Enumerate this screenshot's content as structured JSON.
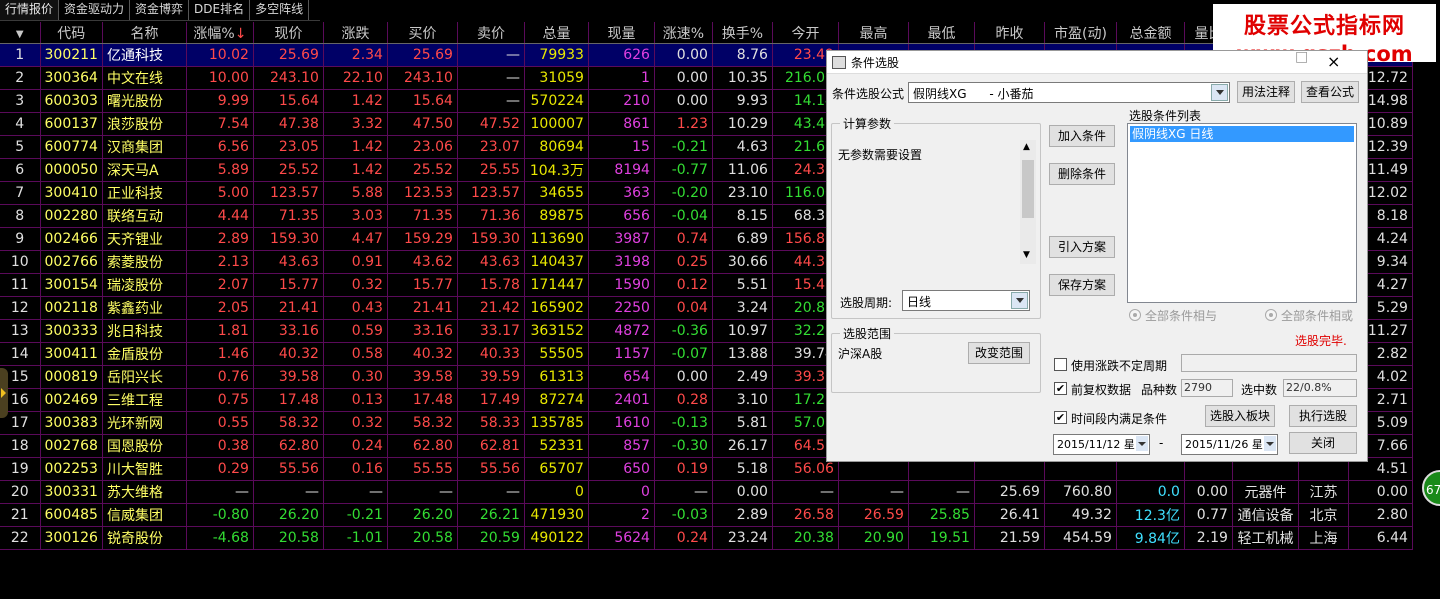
{
  "tabs": [
    "行情报价",
    "资金驱动力",
    "资金博弈",
    "DDE排名",
    "多空阵线"
  ],
  "columns": [
    "",
    "代码",
    "名称",
    "涨幅%",
    "现价",
    "涨跌",
    "买价",
    "卖价",
    "总量",
    "现量",
    "涨速%",
    "换手%",
    "今开",
    "最高",
    "最低",
    "昨收",
    "市盈(动)",
    "总金额",
    "量比",
    "细分行业",
    "地区",
    "振幅%"
  ],
  "rows": [
    [
      "1",
      "300211",
      "亿通科技",
      "10.02",
      "25.69",
      "2.34",
      "25.69",
      "—",
      "79933",
      "626",
      "0.00",
      "8.76",
      "23.49",
      "",
      "",
      "",
      "",
      "",
      "",
      "",
      "",
      ""
    ],
    [
      "2",
      "300364",
      "中文在线",
      "10.00",
      "243.10",
      "22.10",
      "243.10",
      "—",
      "31059",
      "1",
      "0.00",
      "10.35",
      "216.00",
      "",
      "",
      "",
      "",
      "",
      "",
      "",
      "",
      "12.72"
    ],
    [
      "3",
      "600303",
      "曙光股份",
      "9.99",
      "15.64",
      "1.42",
      "15.64",
      "—",
      "570224",
      "210",
      "0.00",
      "9.93",
      "14.14",
      "",
      "",
      "",
      "",
      "",
      "",
      "",
      "",
      "14.98"
    ],
    [
      "4",
      "600137",
      "浪莎股份",
      "7.54",
      "47.38",
      "3.32",
      "47.50",
      "47.52",
      "100007",
      "861",
      "1.23",
      "10.29",
      "43.40",
      "",
      "",
      "",
      "",
      "",
      "",
      "",
      "",
      "10.89"
    ],
    [
      "5",
      "600774",
      "汉商集团",
      "6.56",
      "23.05",
      "1.42",
      "23.06",
      "23.07",
      "80694",
      "15",
      "-0.21",
      "4.63",
      "21.60",
      "",
      "",
      "",
      "",
      "",
      "",
      "",
      "",
      "12.39"
    ],
    [
      "6",
      "000050",
      "深天马A",
      "5.89",
      "25.52",
      "1.42",
      "25.52",
      "25.55",
      "104.3万",
      "8194",
      "-0.77",
      "11.06",
      "24.35",
      "",
      "",
      "",
      "",
      "",
      "",
      "",
      "",
      "11.49"
    ],
    [
      "7",
      "300410",
      "正业科技",
      "5.00",
      "123.57",
      "5.88",
      "123.53",
      "123.57",
      "34655",
      "363",
      "-0.20",
      "23.10",
      "116.00",
      "",
      "",
      "",
      "",
      "",
      "",
      "",
      "",
      "12.02"
    ],
    [
      "8",
      "002280",
      "联络互动",
      "4.44",
      "71.35",
      "3.03",
      "71.35",
      "71.36",
      "89875",
      "656",
      "-0.04",
      "8.15",
      "68.32",
      "",
      "",
      "",
      "",
      "",
      "",
      "",
      "",
      "8.18"
    ],
    [
      "9",
      "002466",
      "天齐锂业",
      "2.89",
      "159.30",
      "4.47",
      "159.29",
      "159.30",
      "113690",
      "3987",
      "0.74",
      "6.89",
      "156.81",
      "",
      "",
      "",
      "",
      "",
      "",
      "",
      "",
      "4.24"
    ],
    [
      "10",
      "002766",
      "索菱股份",
      "2.13",
      "43.63",
      "0.91",
      "43.62",
      "43.63",
      "140437",
      "3198",
      "0.25",
      "30.66",
      "44.33",
      "",
      "",
      "",
      "",
      "",
      "",
      "",
      "",
      "9.34"
    ],
    [
      "11",
      "300154",
      "瑞凌股份",
      "2.07",
      "15.77",
      "0.32",
      "15.77",
      "15.78",
      "171447",
      "1590",
      "0.12",
      "5.51",
      "15.48",
      "",
      "",
      "",
      "",
      "",
      "",
      "",
      "",
      "4.27"
    ],
    [
      "12",
      "002118",
      "紫鑫药业",
      "2.05",
      "21.41",
      "0.43",
      "21.41",
      "21.42",
      "165902",
      "2250",
      "0.04",
      "3.24",
      "20.87",
      "",
      "",
      "",
      "",
      "",
      "",
      "",
      "",
      "5.29"
    ],
    [
      "13",
      "300333",
      "兆日科技",
      "1.81",
      "33.16",
      "0.59",
      "33.16",
      "33.17",
      "363152",
      "4872",
      "-0.36",
      "10.97",
      "32.22",
      "",
      "",
      "",
      "",
      "",
      "",
      "",
      "",
      "11.27"
    ],
    [
      "14",
      "300411",
      "金盾股份",
      "1.46",
      "40.32",
      "0.58",
      "40.32",
      "40.33",
      "55505",
      "1157",
      "-0.07",
      "13.88",
      "39.74",
      "",
      "",
      "",
      "",
      "",
      "",
      "",
      "",
      "2.82"
    ],
    [
      "15",
      "000819",
      "岳阳兴长",
      "0.76",
      "39.58",
      "0.30",
      "39.58",
      "39.59",
      "61313",
      "654",
      "0.00",
      "2.49",
      "39.30",
      "",
      "",
      "",
      "",
      "",
      "",
      "",
      "",
      "4.02"
    ],
    [
      "16",
      "002469",
      "三维工程",
      "0.75",
      "17.48",
      "0.13",
      "17.48",
      "17.49",
      "87274",
      "2401",
      "0.28",
      "3.10",
      "17.23",
      "",
      "",
      "",
      "",
      "",
      "",
      "",
      "",
      "2.71"
    ],
    [
      "17",
      "300383",
      "光环新网",
      "0.55",
      "58.32",
      "0.32",
      "58.32",
      "58.33",
      "135785",
      "1610",
      "-0.13",
      "5.81",
      "57.06",
      "",
      "",
      "",
      "",
      "",
      "",
      "",
      "",
      "5.09"
    ],
    [
      "18",
      "002768",
      "国恩股份",
      "0.38",
      "62.80",
      "0.24",
      "62.80",
      "62.81",
      "52331",
      "857",
      "-0.30",
      "26.17",
      "64.56",
      "",
      "",
      "",
      "",
      "",
      "",
      "",
      "",
      "7.66"
    ],
    [
      "19",
      "002253",
      "川大智胜",
      "0.29",
      "55.56",
      "0.16",
      "55.55",
      "55.56",
      "65707",
      "650",
      "0.19",
      "5.18",
      "56.06",
      "",
      "",
      "",
      "",
      "",
      "",
      "",
      "",
      "4.51"
    ],
    [
      "20",
      "300331",
      "苏大维格",
      "—",
      "—",
      "—",
      "—",
      "—",
      "0",
      "0",
      "—",
      "0.00",
      "—",
      "—",
      "—",
      "25.69",
      "760.80",
      "0.0",
      "0.00",
      "元器件",
      "江苏",
      "0.00"
    ],
    [
      "21",
      "600485",
      "信威集团",
      "-0.80",
      "26.20",
      "-0.21",
      "26.20",
      "26.21",
      "471930",
      "2",
      "-0.03",
      "2.89",
      "26.58",
      "26.59",
      "25.85",
      "26.41",
      "49.32",
      "12.3亿",
      "0.77",
      "通信设备",
      "北京",
      "2.80"
    ],
    [
      "22",
      "300126",
      "锐奇股份",
      "-4.68",
      "20.58",
      "-1.01",
      "20.58",
      "20.59",
      "490122",
      "5624",
      "0.24",
      "23.24",
      "20.38",
      "20.90",
      "19.51",
      "21.59",
      "454.59",
      "9.84亿",
      "2.19",
      "轻工机械",
      "上海",
      "6.44"
    ]
  ],
  "watermark": {
    "line1": "股票公式指标网",
    "line2": "www.gszb.com"
  },
  "badge": "67",
  "dialog": {
    "title": "条件选股",
    "formula_label": "条件选股公式",
    "formula_value": "假阴线XG      - 小番茄",
    "usage_button": "用法注释",
    "view_button": "查看公式",
    "params_group": "计算参数",
    "params_text": "无参数需要设置",
    "add_button": "加入条件",
    "delete_button": "删除条件",
    "import_button": "引入方案",
    "save_button": "保存方案",
    "list_label": "选股条件列表",
    "list_item": "假阴线XG  日线",
    "period_label": "选股周期:",
    "period_value": "日线",
    "radio_and": "全部条件相与",
    "radio_or": "全部条件相或",
    "status": "选股完毕.",
    "range_group": "选股范围",
    "range_value": "沪深A股",
    "change_range_button": "改变范围",
    "use_volatile_label": "使用涨跌不定周期",
    "adjust_label": "前复权数据",
    "count_label": "品种数",
    "count_value": "2790",
    "selected_label": "选中数",
    "selected_value": "22/0.8%",
    "time_label": "时间段内满足条件",
    "to_block_button": "选股入板块",
    "run_button": "执行选股",
    "date_from": "2015/11/12 星",
    "date_sep": "-",
    "date_to": "2015/11/26 星",
    "close_button": "关闭"
  },
  "colors": {
    "up": "#ff4a4a",
    "down": "#33dd33",
    "code": "#ffff66",
    "grid": "#5a0a5a",
    "status": "#e00000"
  }
}
